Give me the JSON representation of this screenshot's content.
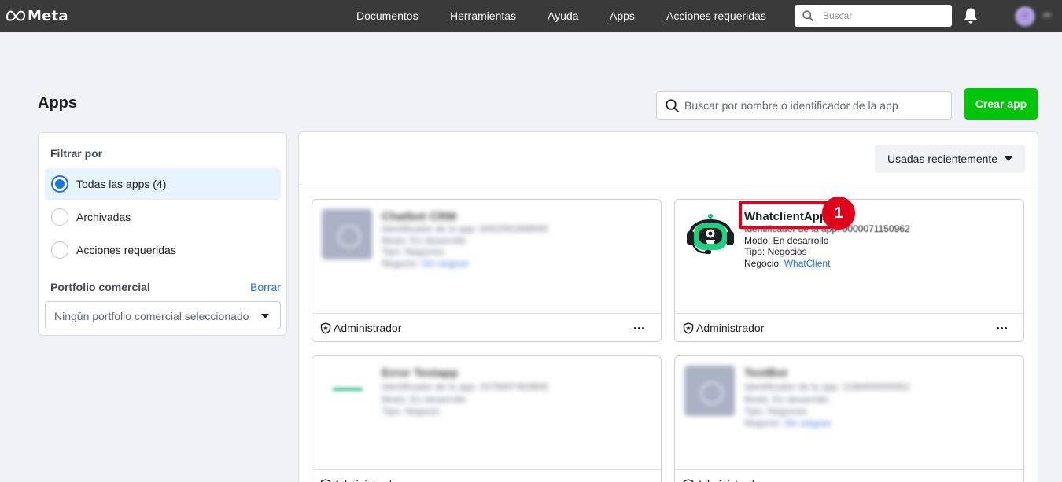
{
  "topbar": {
    "logo_text": "Meta",
    "nav": [
      "Documentos",
      "Herramientas",
      "Ayuda",
      "Apps",
      "Acciones requeridas"
    ],
    "search_placeholder": "Buscar"
  },
  "page": {
    "title": "Apps",
    "search_placeholder": "Buscar por nombre o identificador de la app",
    "create_button": "Crear app"
  },
  "filter": {
    "title": "Filtrar por",
    "options": [
      {
        "label": "Todas las apps (4)",
        "selected": true
      },
      {
        "label": "Archivadas",
        "selected": false
      },
      {
        "label": "Acciones requeridas",
        "selected": false
      }
    ],
    "portfolio_title": "Portfolio comercial",
    "clear_link": "Borrar",
    "portfolio_select": "Ningún portfolio comercial seleccionado"
  },
  "apps_panel": {
    "sort_label": "Usadas recientemente",
    "cards": [
      {
        "title": "Chatbot CRM",
        "id_line": "Identificador de la app: 0002091908000",
        "mode": "Modo: En desarrollo",
        "type": "Tipo: Negocios",
        "business_label": "Negocio:",
        "business": "Sin asignar",
        "role": "Administrador",
        "blurred": true
      },
      {
        "title": "WhatclientApp",
        "id_line": "Identificador de la app: 0000071150962",
        "mode": "Modo: En desarrollo",
        "type": "Tipo: Negocios",
        "business_label": "Negocio:",
        "business": "WhatClient",
        "role": "Administrador",
        "blurred": false
      },
      {
        "title": "Error Testapp",
        "id_line": "Identificador de la app: 2076847463800",
        "mode": "Modo: En desarrollo",
        "type": "Tipo: Negocio",
        "role": "Administrador",
        "blurred": true
      },
      {
        "title": "TestBot",
        "id_line": "Identificador de la app: 1168400000052",
        "mode": "Modo: En desarrollo",
        "type": "Tipo: Negocios",
        "business_label": "Negocio:",
        "business": "Sin asignar",
        "role": "Administrador",
        "blurred": true
      }
    ]
  },
  "annotation": {
    "step_number": "1",
    "color": "#e0001b"
  },
  "colors": {
    "topbar": "#3a3a3a",
    "create_button": "#00c60b",
    "selected_option": "#e7f3ff",
    "link": "#216fdb"
  }
}
